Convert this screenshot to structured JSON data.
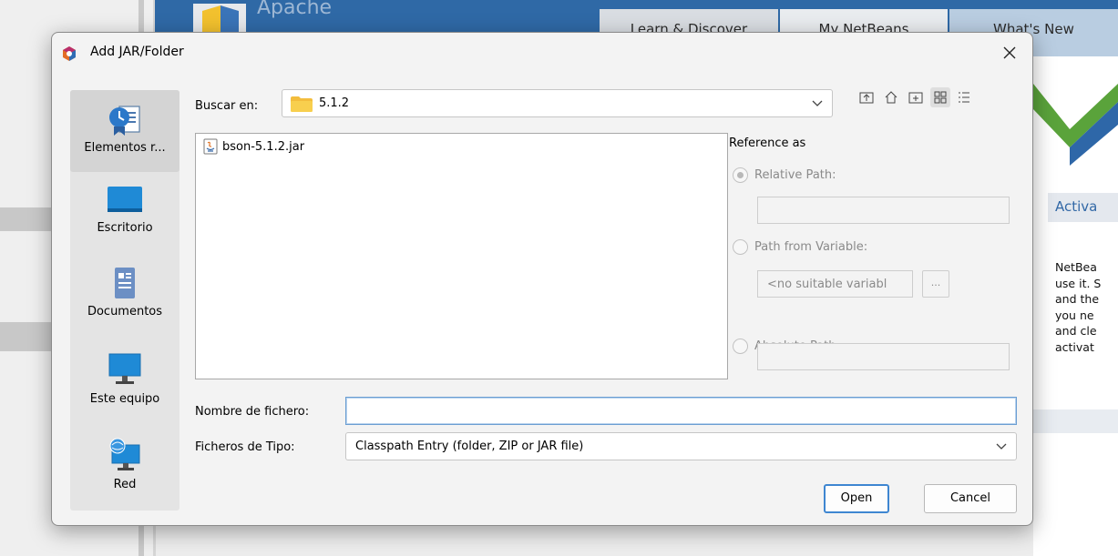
{
  "background": {
    "logo_text": "Apache",
    "tabs": [
      "Learn & Discover",
      "My NetBeans",
      "What's New"
    ],
    "right_panel_heading": "Activa",
    "right_panel_lines": [
      "NetBea",
      "use it. S",
      "and the",
      "you ne",
      "and cle",
      "activat"
    ]
  },
  "dialog": {
    "title": "Add JAR/Folder",
    "places": [
      {
        "label": "Elementos r...",
        "icon": "recent-items-icon",
        "selected": true
      },
      {
        "label": "Escritorio",
        "icon": "desktop-icon",
        "selected": false
      },
      {
        "label": "Documentos",
        "icon": "documents-icon",
        "selected": false
      },
      {
        "label": "Este equipo",
        "icon": "computer-icon",
        "selected": false
      },
      {
        "label": "Red",
        "icon": "network-icon",
        "selected": false
      }
    ],
    "look_in_label": "Buscar en:",
    "look_in_value": "5.1.2",
    "toolbar_icons": [
      "up-folder-icon",
      "home-icon",
      "new-folder-icon",
      "grid-view-icon",
      "list-view-icon"
    ],
    "files": [
      {
        "name": "bson-5.1.2.jar",
        "icon": "jar-file-icon"
      }
    ],
    "reference": {
      "title": "Reference as",
      "relative_path": "Relative Path:",
      "relative_value": "",
      "path_from_variable": "Path from Variable:",
      "variable_value": "<no suitable variabl",
      "browse_label": "...",
      "absolute_path": "Absolute Path:",
      "absolute_value": "",
      "selected": "Relative Path:"
    },
    "filename_label": "Nombre de fichero:",
    "filename_value": "",
    "filetype_label": "Ficheros de Tipo:",
    "filetype_value": "Classpath Entry (folder, ZIP or JAR file)",
    "open_label": "Open",
    "cancel_label": "Cancel"
  }
}
